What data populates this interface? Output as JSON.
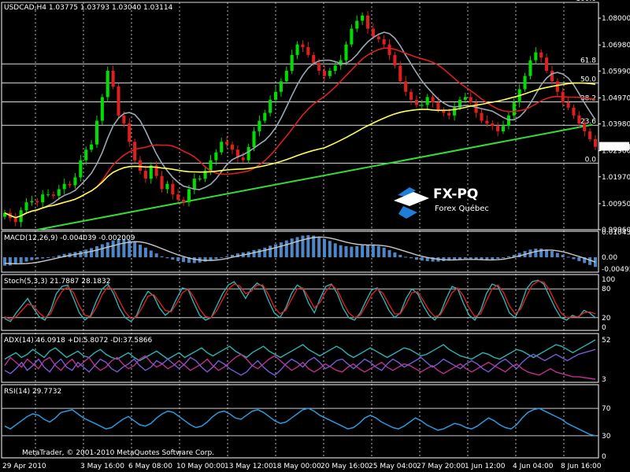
{
  "platform_footer": "MetaTrader, © 2001-2010 MetaQuotes Software Corp.",
  "watermark": {
    "brand": "FX-PQ",
    "subtitle": "Forex Québec"
  },
  "chart_data": [
    {
      "type": "line",
      "panel": "price",
      "title": "USDCAD,H4  1.03775 1.03793 1.03040 1.03114",
      "symbol": "USDCAD",
      "timeframe": "H4",
      "ohlc": {
        "open": 1.03775,
        "high": 1.03793,
        "low": 1.0304,
        "close": 1.03114
      },
      "current_price_label": "1.03114",
      "ylim": [
        0.9996,
        1.086
      ],
      "y_tick_labels": [
        "1.08000",
        "1.06980",
        "1.05990",
        "1.04970",
        "1.03980",
        "1.02960",
        "1.01970",
        "1.00950",
        "0.99960"
      ],
      "x_tick_labels": [
        "29 Apr 2010",
        "3 May 16:00",
        "6 May 08:00",
        "10 May 00:00",
        "13 May 12:00",
        "18 May 00:00",
        "20 May 16:00",
        "25 May 04:00",
        "27 May 20:00",
        "1 Jun 12:00",
        "4 Jun 04:00",
        "8 Jun 16:00"
      ],
      "fibonacci": [
        {
          "label": "100.0",
          "value": 1.086
        },
        {
          "label": "61.8",
          "value": 1.0626
        },
        {
          "label": "50.0",
          "value": 1.0554
        },
        {
          "label": "38.2",
          "value": 1.0482
        },
        {
          "label": "23.6",
          "value": 1.0393
        },
        {
          "label": "0.0",
          "value": 1.0249
        }
      ],
      "trendline": {
        "x": [
          0.06,
          0.99
        ],
        "y": [
          0.9996,
          1.0395
        ]
      },
      "candles": {
        "series": "USDCAD H4 candlesticks (estimated)",
        "close_path": [
          1.006,
          1.004,
          1.0025,
          1.007,
          1.01,
          1.0105,
          1.01,
          1.013,
          1.013,
          1.0125,
          1.015,
          1.017,
          1.0165,
          1.0195,
          1.026,
          1.03,
          1.032,
          1.041,
          1.05,
          1.06,
          1.054,
          1.043,
          1.04,
          1.033,
          1.026,
          1.022,
          1.019,
          1.024,
          1.02,
          1.015,
          1.017,
          1.013,
          1.011,
          1.01,
          1.015,
          1.019,
          1.019,
          1.022,
          1.026,
          1.029,
          1.033,
          1.032,
          1.03,
          1.027,
          1.026,
          1.031,
          1.037,
          1.041,
          1.044,
          1.049,
          1.052,
          1.056,
          1.06,
          1.066,
          1.07,
          1.069,
          1.066,
          1.063,
          1.06,
          1.058,
          1.06,
          1.062,
          1.064,
          1.07,
          1.076,
          1.079,
          1.081,
          1.076,
          1.073,
          1.072,
          1.07,
          1.066,
          1.062,
          1.056,
          1.052,
          1.049,
          1.047,
          1.047,
          1.05,
          1.048,
          1.045,
          1.044,
          1.043,
          1.046,
          1.049,
          1.05,
          1.048,
          1.044,
          1.041,
          1.04,
          1.039,
          1.037,
          1.039,
          1.043,
          1.048,
          1.053,
          1.058,
          1.064,
          1.067,
          1.065,
          1.06,
          1.056,
          1.052,
          1.048,
          1.046,
          1.043,
          1.04,
          1.037,
          1.034,
          1.0311
        ],
        "range": 0.004
      },
      "moving_averages": [
        {
          "color": "#9aa8b4",
          "period": 8
        },
        {
          "color": "#dd1f1f",
          "period": 18
        },
        {
          "color": "#ffff55",
          "period": 60
        }
      ]
    },
    {
      "type": "bar",
      "panel": "macd",
      "title": "MACD(12,26,9) -0.004039 -0.002009",
      "y_tick_labels": [
        "0.010431",
        "0.00",
        "-0.004950"
      ],
      "ylim": [
        -0.0062,
        0.0108
      ],
      "histogram": [
        -0.0035,
        -0.0034,
        -0.003,
        -0.0024,
        -0.0018,
        -0.0012,
        -0.0008,
        -0.0005,
        -0.0002,
        0.0002,
        0.0008,
        0.0014,
        0.0018,
        0.0022,
        0.0026,
        0.0032,
        0.0038,
        0.0046,
        0.0054,
        0.0062,
        0.007,
        0.0074,
        0.0076,
        0.0072,
        0.0066,
        0.0052,
        0.004,
        0.0028,
        0.0016,
        0.0004,
        -0.0004,
        -0.001,
        -0.0016,
        -0.002,
        -0.0023,
        -0.0024,
        -0.0022,
        -0.0018,
        -0.0014,
        -0.0008,
        -0.0002,
        0.0004,
        0.001,
        0.0016,
        0.002,
        0.0024,
        0.003,
        0.0034,
        0.004,
        0.0048,
        0.0054,
        0.0062,
        0.007,
        0.0078,
        0.0084,
        0.009,
        0.0092,
        0.009,
        0.0084,
        0.0076,
        0.0068,
        0.0058,
        0.005,
        0.0046,
        0.0044,
        0.0046,
        0.005,
        0.0052,
        0.005,
        0.0046,
        0.004,
        0.003,
        0.002,
        0.001,
        0.0002,
        -0.0004,
        -0.001,
        -0.0014,
        -0.0016,
        -0.0018,
        -0.0018,
        -0.0016,
        -0.0014,
        -0.001,
        -0.0008,
        -0.0006,
        -0.0008,
        -0.001,
        -0.0012,
        -0.0012,
        -0.001,
        -0.0006,
        -0.0002,
        0.0004,
        0.001,
        0.0018,
        0.0026,
        0.0032,
        0.0036,
        0.0036,
        0.0032,
        0.0026,
        0.0018,
        0.001,
        0.0002,
        -0.0008,
        -0.0016,
        -0.0024,
        -0.0032,
        -0.004
      ],
      "signal": [
        -0.0025,
        -0.0026,
        -0.0027,
        -0.0027,
        -0.0026,
        -0.0024,
        -0.0021,
        -0.0017,
        -0.0012,
        -0.0007,
        -0.0002,
        0.0003,
        0.0008,
        0.0012,
        0.0016,
        0.002,
        0.0025,
        0.003,
        0.0036,
        0.0042,
        0.0048,
        0.0054,
        0.0059,
        0.0063,
        0.0065,
        0.0064,
        0.006,
        0.0053,
        0.0045,
        0.0036,
        0.0027,
        0.0018,
        0.001,
        0.0003,
        -0.0003,
        -0.0008,
        -0.0011,
        -0.0013,
        -0.0013,
        -0.0012,
        -0.0009,
        -0.0005,
        0.0,
        0.0005,
        0.001,
        0.0014,
        0.0019,
        0.0024,
        0.0029,
        0.0034,
        0.004,
        0.0046,
        0.0052,
        0.0059,
        0.0066,
        0.0072,
        0.0078,
        0.0082,
        0.0084,
        0.0083,
        0.008,
        0.0075,
        0.0069,
        0.0063,
        0.0058,
        0.0054,
        0.0052,
        0.0051,
        0.0051,
        0.005,
        0.0048,
        0.0044,
        0.0038,
        0.0031,
        0.0024,
        0.0017,
        0.001,
        0.0004,
        -0.0001,
        -0.0005,
        -0.0008,
        -0.001,
        -0.0011,
        -0.0011,
        -0.001,
        -0.0009,
        -0.0009,
        -0.0009,
        -0.001,
        -0.0011,
        -0.0011,
        -0.001,
        -0.0008,
        -0.0004,
        0.0,
        0.0006,
        0.0012,
        0.0018,
        0.0024,
        0.0028,
        0.003,
        0.003,
        0.0027,
        0.0023,
        0.0017,
        0.001,
        0.0003,
        -0.0004,
        -0.0012,
        -0.002
      ]
    },
    {
      "type": "line",
      "panel": "stochastic",
      "title": "Stoch(5,3,3) 21.7887 28.1832",
      "y_tick_labels": [
        "100",
        "80",
        "20",
        "0"
      ],
      "ylim": [
        0,
        100
      ],
      "levels": [
        80,
        20
      ],
      "series": [
        {
          "color": "#2ab5b5",
          "values": [
            18,
            12,
            30,
            45,
            60,
            40,
            22,
            15,
            35,
            70,
            85,
            88,
            60,
            30,
            15,
            25,
            55,
            80,
            90,
            70,
            40,
            20,
            12,
            25,
            55,
            75,
            65,
            40,
            25,
            35,
            60,
            82,
            78,
            50,
            25,
            15,
            20,
            45,
            70,
            88,
            95,
            80,
            60,
            80,
            92,
            85,
            55,
            30,
            20,
            40,
            70,
            88,
            80,
            50,
            30,
            60,
            85,
            90,
            70,
            40,
            20,
            15,
            30,
            55,
            78,
            82,
            60,
            35,
            20,
            30,
            60,
            80,
            70,
            45,
            25,
            15,
            30,
            60,
            85,
            80,
            50,
            25,
            15,
            35,
            70,
            90,
            85,
            60,
            30,
            20,
            45,
            80,
            95,
            98,
            90,
            65,
            40,
            20,
            15,
            25,
            20,
            35,
            30,
            20
          ]
        },
        {
          "color": "#dd1f1f",
          "values": [
            22,
            16,
            22,
            35,
            48,
            45,
            30,
            20,
            28,
            55,
            75,
            85,
            72,
            45,
            25,
            22,
            42,
            68,
            85,
            78,
            55,
            32,
            18,
            22,
            42,
            65,
            68,
            52,
            35,
            32,
            50,
            72,
            80,
            62,
            38,
            22,
            20,
            35,
            58,
            80,
            90,
            86,
            70,
            75,
            88,
            88,
            68,
            42,
            28,
            35,
            58,
            80,
            82,
            62,
            40,
            52,
            75,
            88,
            78,
            52,
            30,
            20,
            25,
            45,
            68,
            80,
            70,
            48,
            28,
            28,
            48,
            72,
            74,
            55,
            35,
            22,
            26,
            48,
            72,
            82,
            65,
            40,
            22,
            28,
            55,
            80,
            88,
            72,
            45,
            28,
            38,
            65,
            88,
            96,
            94,
            78,
            52,
            30,
            20,
            22,
            22,
            30,
            32,
            28
          ]
        }
      ]
    },
    {
      "type": "line",
      "panel": "adx",
      "title": "ADX(14) 46.0918 +DI:5.8072 -DI:37.5866",
      "y_tick_labels": [
        "52",
        "3"
      ],
      "ylim": [
        3,
        52
      ],
      "series": [
        {
          "color": "#2ab5b5",
          "values": [
            28,
            32,
            36,
            30,
            34,
            40,
            35,
            30,
            38,
            42,
            36,
            30,
            34,
            38,
            32,
            30,
            36,
            40,
            34,
            30,
            28,
            32,
            36,
            30,
            26,
            30,
            34,
            38,
            33,
            28,
            32,
            36,
            30,
            34,
            38,
            42,
            36,
            32,
            36,
            40,
            44,
            38,
            34,
            30,
            36,
            40,
            44,
            38,
            34,
            30,
            34,
            38,
            42,
            46,
            40,
            36,
            32,
            36,
            40,
            44,
            40,
            34,
            30,
            34,
            38,
            42,
            38,
            34,
            30,
            34,
            38,
            42,
            40,
            36,
            32,
            34,
            38,
            42,
            46,
            40,
            36,
            32,
            30,
            28,
            32,
            36,
            34,
            30,
            28,
            32,
            36,
            40,
            38,
            34,
            30,
            34,
            38,
            42,
            46,
            44,
            40,
            36,
            40,
            44,
            48,
            52
          ]
        },
        {
          "color": "#c03090",
          "values": [
            20,
            30,
            24,
            18,
            28,
            22,
            16,
            26,
            30,
            20,
            14,
            22,
            28,
            18,
            24,
            30,
            20,
            14,
            18,
            26,
            30,
            22,
            16,
            20,
            28,
            32,
            24,
            18,
            22,
            16,
            20,
            26,
            20,
            14,
            18,
            22,
            28,
            20,
            14,
            18,
            24,
            30,
            34,
            28,
            20,
            16,
            22,
            28,
            32,
            26,
            20,
            14,
            18,
            24,
            16,
            12,
            16,
            22,
            18,
            14,
            12,
            18,
            22,
            16,
            12,
            16,
            20,
            24,
            18,
            14,
            18,
            22,
            20,
            16,
            12,
            16,
            20,
            14,
            10,
            14,
            18,
            22,
            16,
            12,
            16,
            20,
            24,
            20,
            16,
            12,
            18,
            22,
            16,
            12,
            10,
            8,
            12,
            16,
            12,
            10,
            8,
            6,
            6,
            5,
            4,
            3
          ]
        },
        {
          "color": "#7a5ad0",
          "values": [
            14,
            10,
            16,
            24,
            14,
            20,
            28,
            18,
            12,
            22,
            28,
            18,
            14,
            24,
            18,
            12,
            20,
            28,
            24,
            16,
            12,
            18,
            22,
            28,
            20,
            14,
            18,
            26,
            22,
            28,
            22,
            16,
            22,
            30,
            26,
            18,
            12,
            18,
            26,
            22,
            16,
            12,
            8,
            12,
            20,
            26,
            18,
            12,
            8,
            14,
            22,
            28,
            24,
            18,
            26,
            30,
            24,
            16,
            20,
            26,
            28,
            22,
            16,
            22,
            28,
            24,
            18,
            14,
            22,
            28,
            24,
            18,
            22,
            26,
            30,
            24,
            18,
            22,
            28,
            24,
            20,
            16,
            22,
            26,
            22,
            16,
            12,
            18,
            24,
            28,
            22,
            16,
            24,
            30,
            34,
            30,
            26,
            30,
            34,
            30,
            26,
            30,
            34,
            36,
            38,
            40
          ]
        }
      ]
    },
    {
      "type": "line",
      "panel": "rsi",
      "title": "RSI(14) 29.7732",
      "y_tick_labels": [
        "70",
        "30",
        "0"
      ],
      "ylim": [
        0,
        100
      ],
      "levels": [
        70,
        30
      ],
      "series": [
        {
          "color": "#2a9adf",
          "values": [
            44,
            40,
            46,
            52,
            58,
            62,
            60,
            54,
            50,
            56,
            64,
            66,
            68,
            62,
            56,
            52,
            48,
            44,
            40,
            42,
            48,
            54,
            58,
            52,
            46,
            44,
            48,
            56,
            62,
            66,
            64,
            58,
            52,
            46,
            42,
            44,
            50,
            58,
            64,
            66,
            62,
            56,
            54,
            60,
            66,
            68,
            64,
            58,
            52,
            48,
            50,
            56,
            62,
            68,
            70,
            66,
            60,
            56,
            52,
            48,
            44,
            40,
            42,
            48,
            56,
            60,
            56,
            50,
            46,
            42,
            40,
            44,
            50,
            56,
            52,
            46,
            42,
            38,
            40,
            44,
            48,
            46,
            42,
            40,
            44,
            50,
            56,
            52,
            46,
            42,
            40,
            46,
            56,
            64,
            68,
            70,
            66,
            62,
            58,
            54,
            48,
            44,
            40,
            36,
            32,
            30
          ]
        }
      ]
    }
  ]
}
